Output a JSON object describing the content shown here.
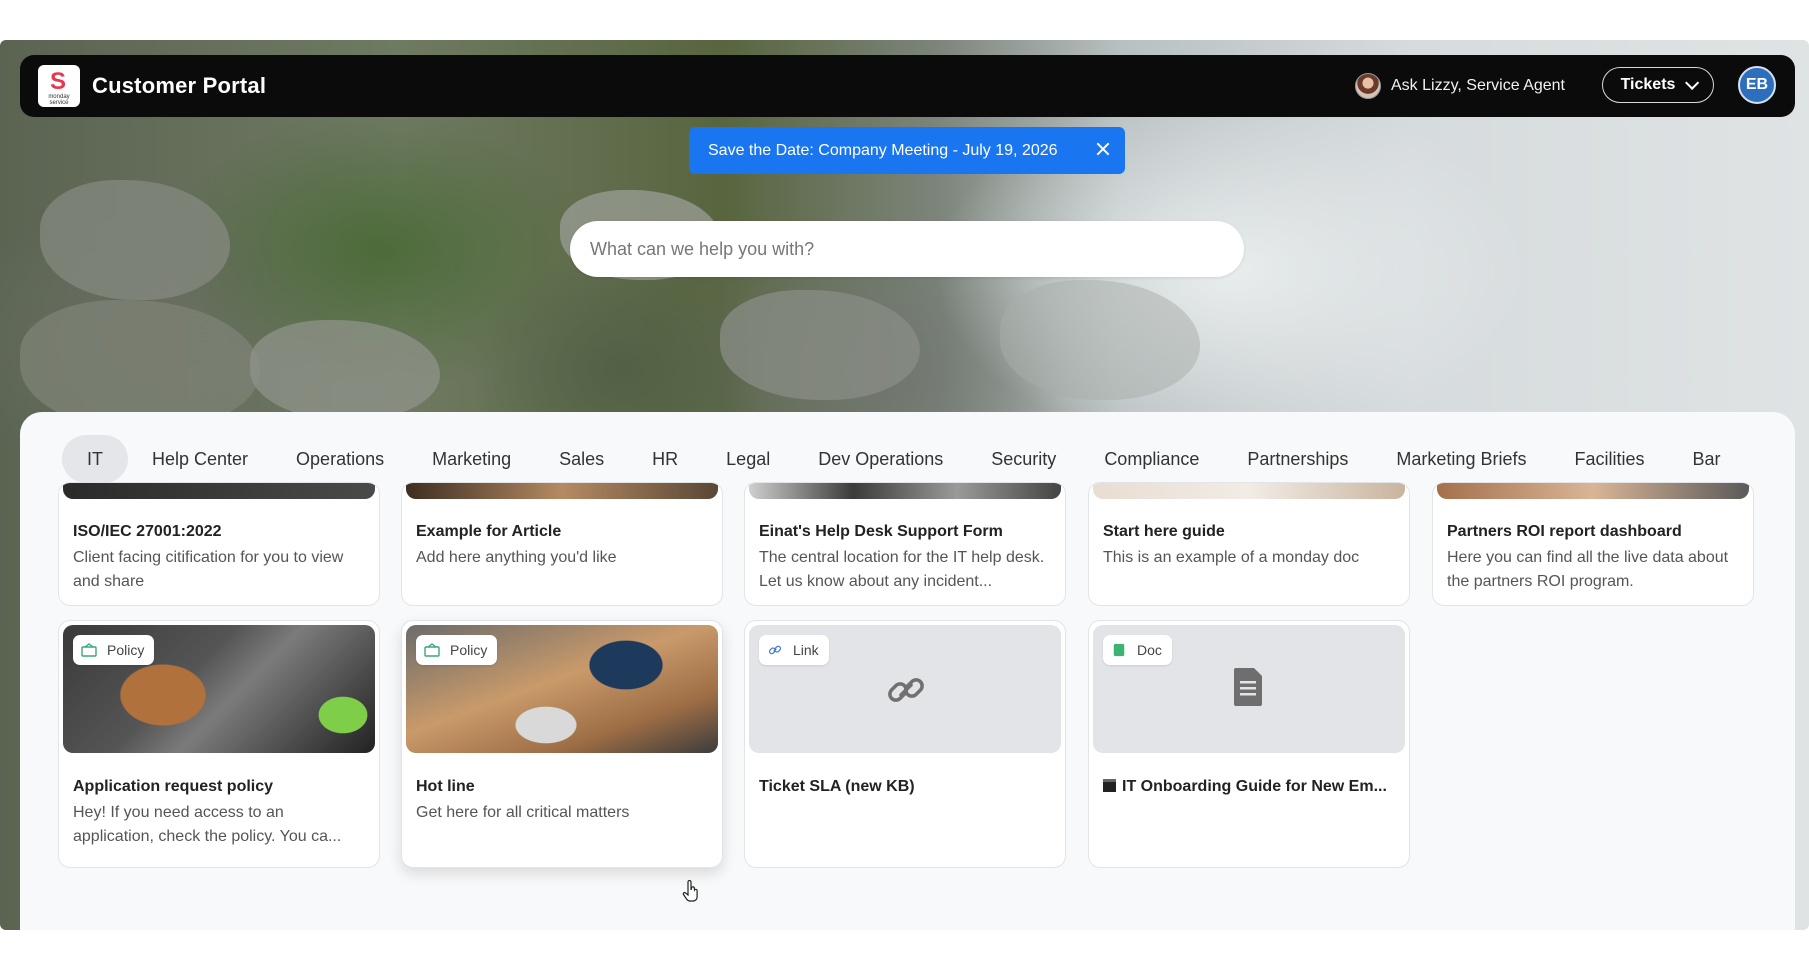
{
  "header": {
    "title": "Customer Portal",
    "logo_brand": "monday",
    "logo_sub": "service",
    "agent_label": "Ask Lizzy, Service Agent",
    "tickets_label": "Tickets",
    "user_initials": "EB"
  },
  "banner": {
    "text": "Save the Date: Company Meeting - July 19, 2026",
    "color": "#1976f0"
  },
  "search": {
    "placeholder": "What can we help you with?"
  },
  "tabs": [
    {
      "label": "IT",
      "active": true
    },
    {
      "label": "Help Center"
    },
    {
      "label": "Operations"
    },
    {
      "label": "Marketing"
    },
    {
      "label": "Sales"
    },
    {
      "label": "HR"
    },
    {
      "label": "Legal"
    },
    {
      "label": "Dev Operations"
    },
    {
      "label": "Security"
    },
    {
      "label": "Compliance"
    },
    {
      "label": "Partnerships"
    },
    {
      "label": "Marketing Briefs"
    },
    {
      "label": "Facilities"
    },
    {
      "label": "Bar"
    }
  ],
  "cards_row1": [
    {
      "title": "ISO/IEC 27001:2022",
      "desc": "Client facing citification for you to view and share"
    },
    {
      "title": "Example for Article",
      "desc": "Add here anything you'd like"
    },
    {
      "title": "Einat's Help Desk Support Form",
      "desc": "The central location for the IT help desk. Let us know about any incident..."
    },
    {
      "title": "Start here guide",
      "desc": "This is an example of a monday doc"
    },
    {
      "title": "Partners ROI report dashboard",
      "desc": "Here you can find all the live data about the partners ROI program."
    }
  ],
  "cards_row2": [
    {
      "badge": "Policy",
      "title": "Application request policy",
      "desc": "Hey! If you need access to an application, check the policy. You ca..."
    },
    {
      "badge": "Policy",
      "title": "Hot line",
      "desc": "Get here for all critical matters"
    },
    {
      "badge": "Link",
      "title": "Ticket SLA (new KB)",
      "desc": ""
    },
    {
      "badge": "Doc",
      "title": "IT Onboarding Guide for New Em...",
      "desc": ""
    }
  ]
}
